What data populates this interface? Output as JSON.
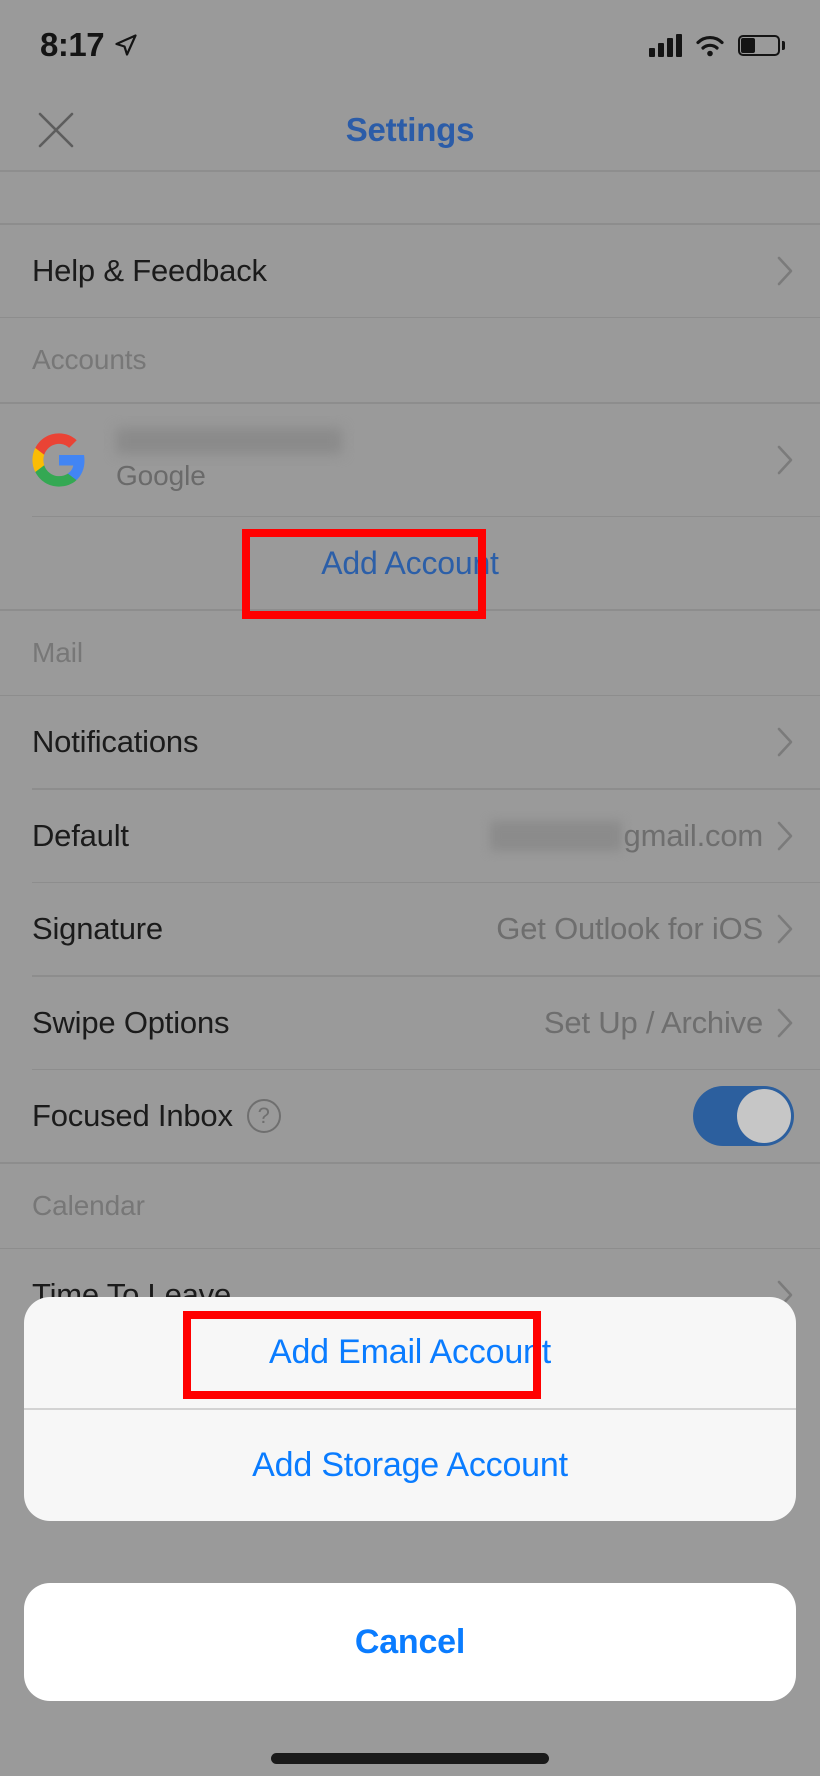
{
  "status_bar": {
    "time": "8:17",
    "location_icon": "location-arrow-icon",
    "signal_icon": "cellular-signal-icon",
    "wifi_icon": "wifi-icon",
    "battery_icon": "battery-icon"
  },
  "nav": {
    "close_icon": "close-icon",
    "title": "Settings"
  },
  "general": {
    "help_feedback": "Help & Feedback"
  },
  "accounts_section": {
    "header": "Accounts",
    "account": {
      "provider_icon": "google-logo-icon",
      "email_redacted": "",
      "provider": "Google"
    },
    "add_account": "Add Account"
  },
  "mail_section": {
    "header": "Mail",
    "rows": [
      {
        "title": "Notifications",
        "value": ""
      },
      {
        "title": "Default",
        "value": "gmail.com",
        "value_has_blur_prefix": true
      },
      {
        "title": "Signature",
        "value": "Get Outlook for iOS"
      },
      {
        "title": "Swipe Options",
        "value": "Set Up / Archive"
      },
      {
        "title": "Focused Inbox",
        "value": "",
        "help_badge": "?",
        "toggle": "on"
      }
    ]
  },
  "calendar_section": {
    "header": "Calendar",
    "rows": [
      {
        "title": "Time To Leave",
        "value": ""
      }
    ]
  },
  "action_sheet": {
    "items": [
      "Add Email Account",
      "Add Storage Account"
    ],
    "cancel": "Cancel"
  },
  "annotations": [
    {
      "target": "Add Account",
      "color": "#ff0000"
    },
    {
      "target": "Add Email Account",
      "color": "#ff0000"
    }
  ],
  "colors": {
    "ios_blue": "#0a7cff",
    "dim_overlay_blue": "#2c5fa8",
    "toggle_on": "#2c5f9e",
    "annotation_red": "#ff0000",
    "dim_background": "#9a9a9a"
  }
}
